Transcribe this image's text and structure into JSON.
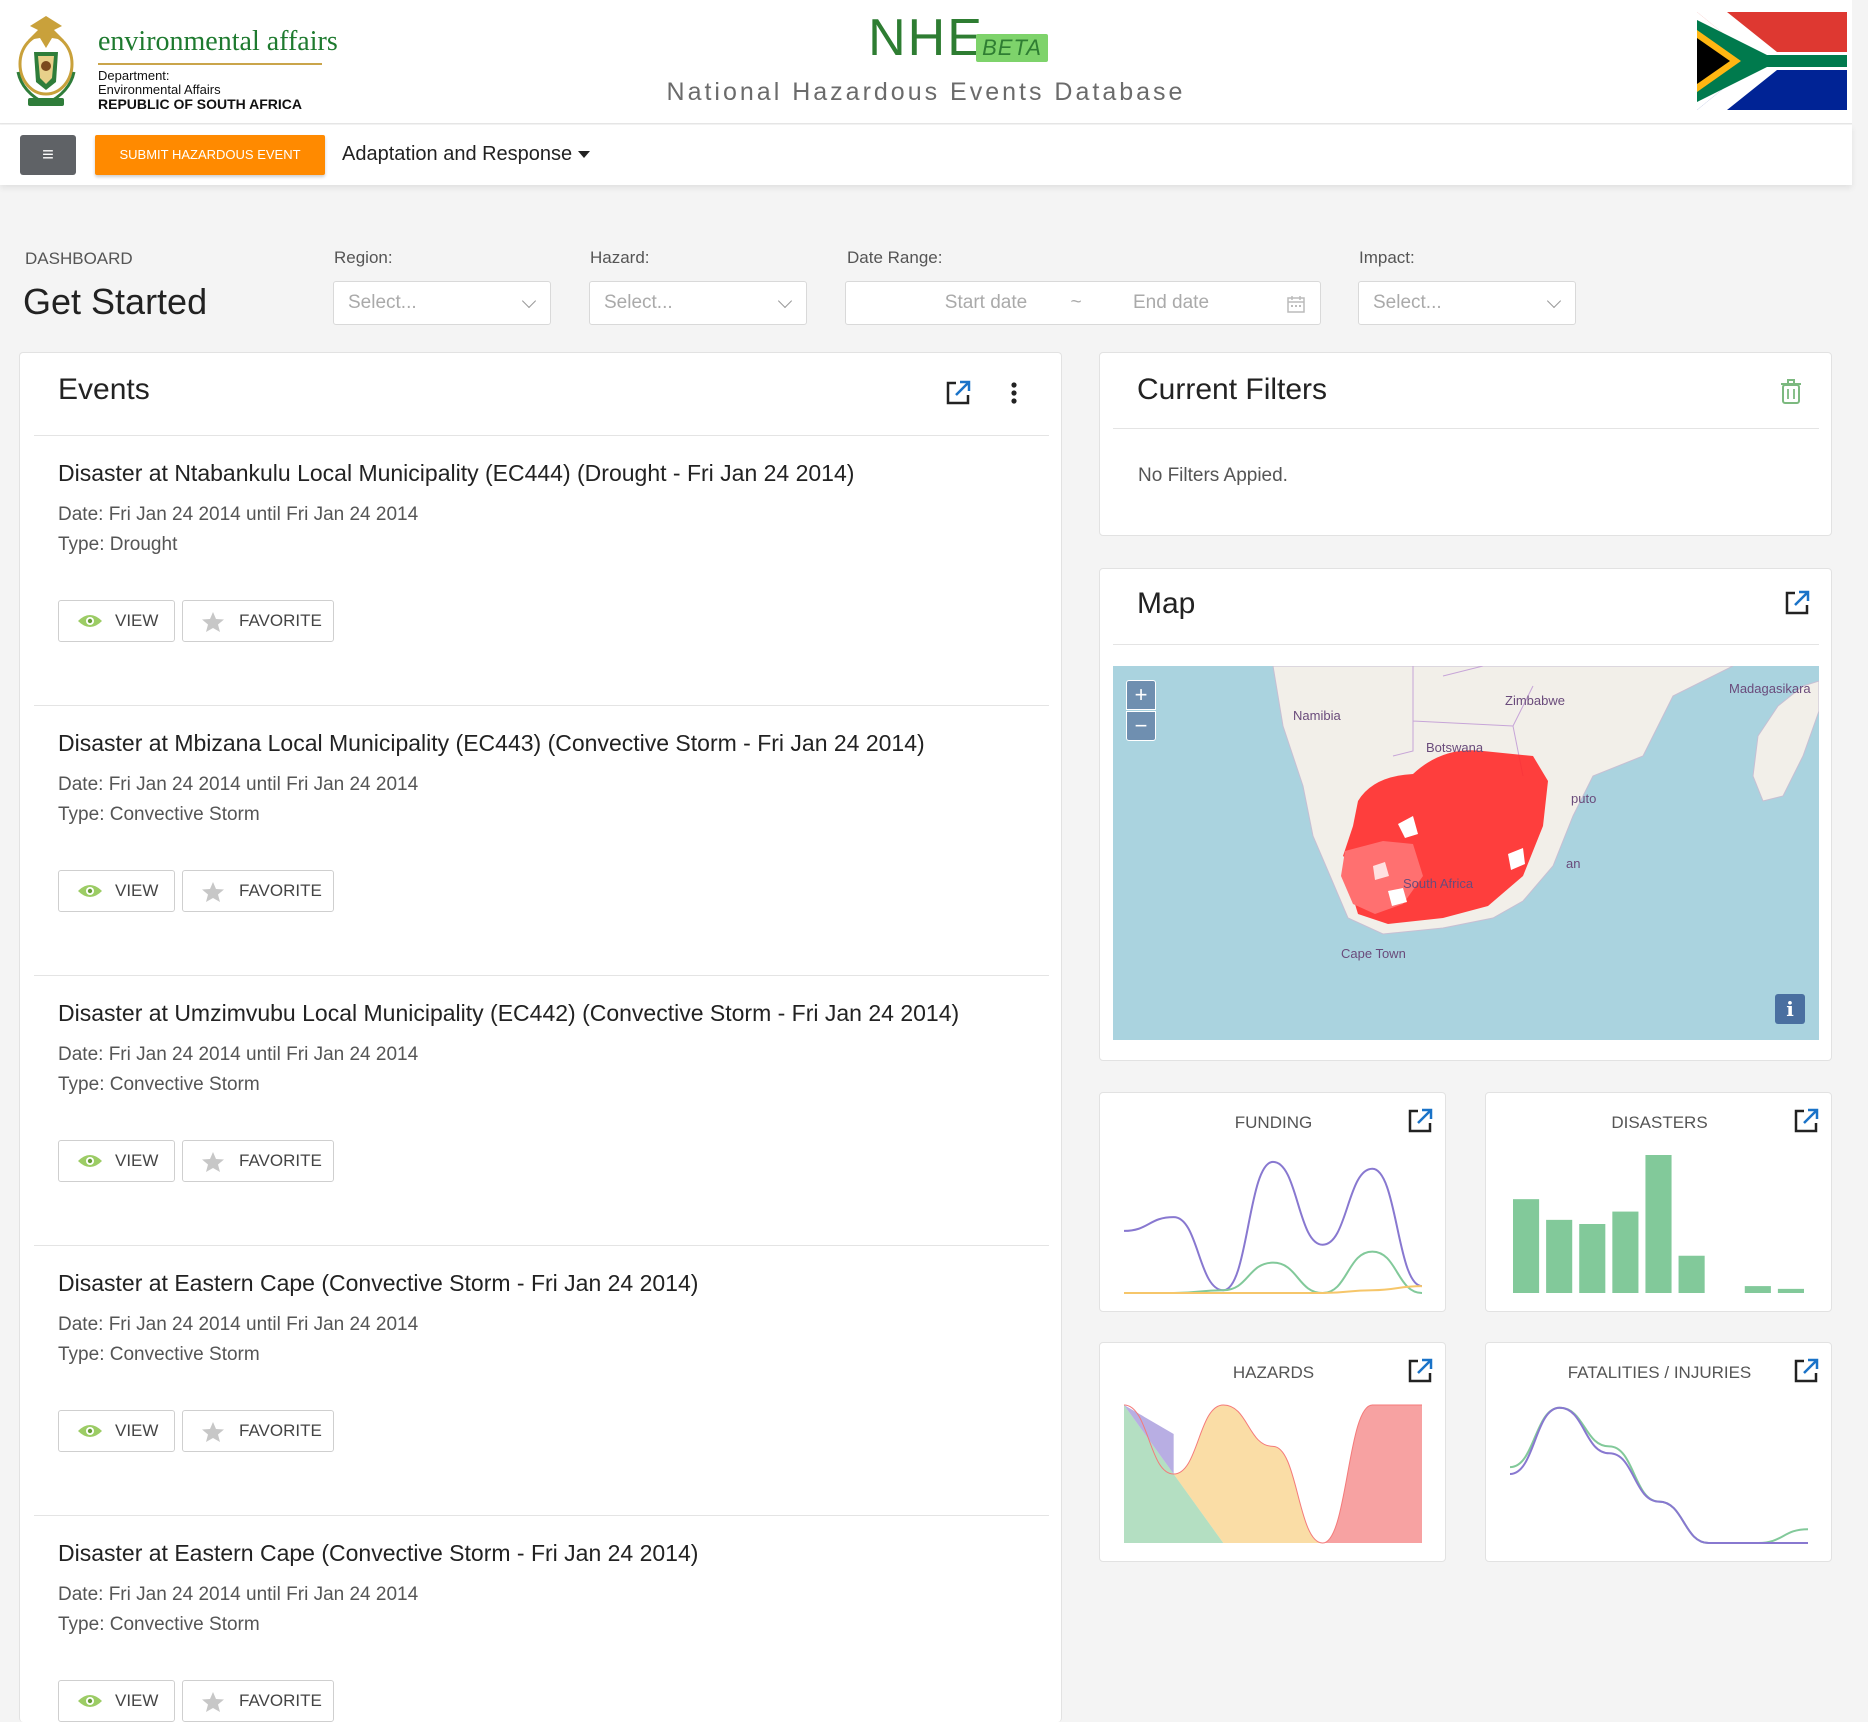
{
  "header": {
    "logo_main": "environmental affairs",
    "logo_line1": "Department:",
    "logo_line2": "Environmental Affairs",
    "logo_line3": "REPUBLIC OF SOUTH AFRICA",
    "brand_title": "NHE",
    "brand_beta": "BETA",
    "brand_subtitle": "National Hazardous Events Database"
  },
  "nav": {
    "menu_icon": "≡",
    "submit_label": "SUBMIT HAZARDOUS EVENT",
    "adaptation_label": "Adaptation and Response"
  },
  "dashboard": {
    "section_label": "DASHBOARD",
    "title": "Get Started",
    "filters": {
      "region_label": "Region:",
      "region_placeholder": "Select...",
      "hazard_label": "Hazard:",
      "hazard_placeholder": "Select...",
      "date_label": "Date Range:",
      "start_placeholder": "Start date",
      "separator": "~",
      "end_placeholder": "End date",
      "impact_label": "Impact:",
      "impact_placeholder": "Select..."
    }
  },
  "events": {
    "title": "Events",
    "view_label": "VIEW",
    "favorite_label": "FAVORITE",
    "items": [
      {
        "title": "Disaster at Ntabankulu Local Municipality (EC444) (Drought - Fri Jan 24 2014)",
        "date": "Date: Fri Jan 24 2014 until Fri Jan 24 2014",
        "type": "Type: Drought"
      },
      {
        "title": "Disaster at Mbizana Local Municipality (EC443) (Convective Storm - Fri Jan 24 2014)",
        "date": "Date: Fri Jan 24 2014 until Fri Jan 24 2014",
        "type": "Type: Convective Storm"
      },
      {
        "title": "Disaster at Umzimvubu Local Municipality (EC442) (Convective Storm - Fri Jan 24 2014)",
        "date": "Date: Fri Jan 24 2014 until Fri Jan 24 2014",
        "type": "Type: Convective Storm"
      },
      {
        "title": "Disaster at Eastern Cape (Convective Storm - Fri Jan 24 2014)",
        "date": "Date: Fri Jan 24 2014 until Fri Jan 24 2014",
        "type": "Type: Convective Storm"
      },
      {
        "title": "Disaster at Eastern Cape (Convective Storm - Fri Jan 24 2014)",
        "date": "Date: Fri Jan 24 2014 until Fri Jan 24 2014",
        "type": "Type: Convective Storm"
      }
    ]
  },
  "current_filters": {
    "title": "Current Filters",
    "empty_text": "No Filters Appied."
  },
  "map": {
    "title": "Map",
    "zoom_in": "+",
    "zoom_out": "−",
    "info": "i",
    "labels": {
      "namibia": "Namibia",
      "botswana": "Botswana",
      "zimbabwe": "Zimbabwe",
      "madagascar": "Madagasikara",
      "maputo": "puto",
      "durban": "an",
      "south_africa": "South Africa",
      "cape_town": "Cape Town"
    }
  },
  "mini_charts": {
    "funding": "FUNDING",
    "disasters": "DISASTERS",
    "hazards": "HAZARDS",
    "fatalities": "FATALITIES / INJURIES"
  },
  "colors": {
    "brand_green": "#2e7d32",
    "beta_bg": "#7ed36b",
    "accent_orange": "#ff8a00",
    "link_blue": "#1a73c8",
    "series_purple": "#8878d0",
    "series_green": "#82c99a",
    "series_orange": "#f6c66a",
    "series_red": "#f47a7a",
    "map_water": "#aad3df",
    "map_highlight": "#ff1a1a"
  },
  "chart_data": [
    {
      "type": "line",
      "title": "FUNDING",
      "x": [
        1,
        2,
        3,
        4,
        5,
        6,
        7
      ],
      "series": [
        {
          "values": [
            0.45,
            0.55,
            0.02,
            0.95,
            0.35,
            0.9,
            0.05
          ]
        },
        {
          "values": [
            0.0,
            0.0,
            0.02,
            0.22,
            0.0,
            0.3,
            0.0
          ]
        },
        {
          "values": [
            0.0,
            0.0,
            0.0,
            0.0,
            0.0,
            0.02,
            0.05
          ]
        }
      ]
    },
    {
      "type": "bar",
      "title": "DISASTERS",
      "categories": [
        "1",
        "2",
        "3",
        "4",
        "5",
        "6",
        "7",
        "8",
        "9"
      ],
      "values": [
        68,
        53,
        50,
        59,
        100,
        27,
        0,
        5,
        3
      ]
    },
    {
      "type": "area",
      "title": "HAZARDS",
      "x": [
        1,
        2,
        3,
        4,
        5,
        6,
        7
      ],
      "series": [
        {
          "values": [
            1.0,
            0.5,
            1.0,
            0.7,
            0.0,
            1.0,
            1.0
          ]
        }
      ]
    },
    {
      "type": "line",
      "title": "FATALITIES / INJURIES",
      "x": [
        1,
        2,
        3,
        4,
        5,
        6,
        7
      ],
      "series": [
        {
          "values": [
            0.55,
            0.98,
            0.7,
            0.3,
            0.0,
            0.0,
            0.1
          ]
        },
        {
          "values": [
            0.5,
            0.98,
            0.65,
            0.3,
            0.0,
            0.0,
            0.0
          ]
        }
      ]
    }
  ]
}
